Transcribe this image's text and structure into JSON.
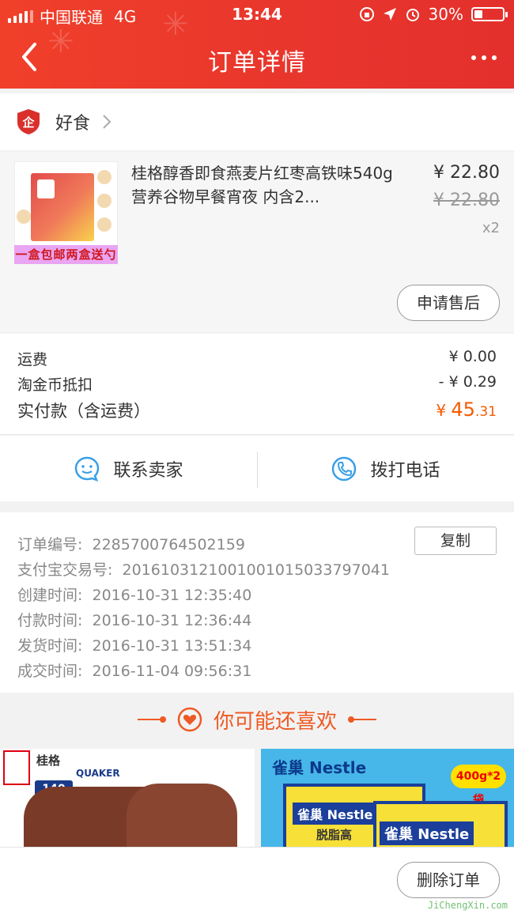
{
  "status_bar": {
    "carrier": "中国联通",
    "network": "4G",
    "time": "13:44",
    "battery": "30%",
    "battery_level": 0.3
  },
  "header": {
    "title": "订单详情",
    "back_icon": "chevron-left-icon",
    "more_icon": "more-dots-icon"
  },
  "shop": {
    "name": "好食",
    "badge_text": "企"
  },
  "product": {
    "title": "桂格醇香即食燕麦片红枣高铁味540g营养谷物早餐宵夜 内含2...",
    "price": "¥ 22.80",
    "original_price": "¥ 22.80",
    "quantity": "x2",
    "promo_text": "一盒包邮两盒送勺",
    "after_sale_button": "申请售后"
  },
  "fees": {
    "shipping_label": "运费",
    "shipping_value": "¥ 0.00",
    "coin_label": "淘金币抵扣",
    "coin_value": "- ¥ 0.29",
    "total_label": "实付款（含运费）",
    "total_currency": "¥",
    "total_int": "45",
    "total_dec": ".31"
  },
  "contact": {
    "seller_label": "联系卖家",
    "phone_label": "拨打电话"
  },
  "order_info": {
    "order_no_label": "订单编号:",
    "order_no": "2285700764502159",
    "copy_button": "复制",
    "alipay_label": "支付宝交易号:",
    "alipay_no": "2016103121001001015033797041",
    "created_label": "创建时间:",
    "created": "2016-10-31 12:35:40",
    "paid_label": "付款时间:",
    "paid": "2016-10-31 12:36:44",
    "shipped_label": "发货时间:",
    "shipped": "2016-10-31 13:51:34",
    "closed_label": "成交时间:",
    "closed": "2016-11-04 09:56:31"
  },
  "recommend": {
    "title": "你可能还喜欢",
    "item1_brand": "桂格",
    "item1_sub": "QUAKER",
    "item1_badge": "140",
    "item2_brand": "雀巢 Nestle",
    "item2_tag": "400g*2袋",
    "item2_label": "雀巢 Nestle",
    "item2_label2": "雀巢 Nestle",
    "item2_sub": "脱脂高"
  },
  "bottom": {
    "delete_button": "删除订单"
  },
  "watermark": "JiChengXin.com",
  "colors": {
    "header_red": "#e8352d",
    "accent_orange": "#f55a00",
    "icon_blue": "#3aa0e6",
    "shop_badge_red": "#d9302c"
  }
}
